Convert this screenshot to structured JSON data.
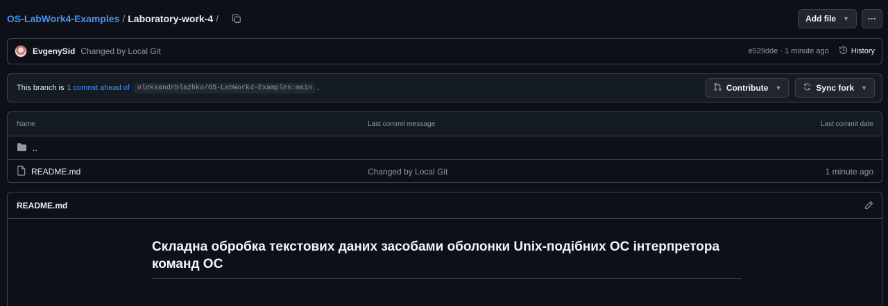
{
  "breadcrumb": {
    "repo": "OS-LabWork4-Examples",
    "separator": "/",
    "folder": "Laboratory-work-4",
    "trailing": "/"
  },
  "toolbar": {
    "add_file_label": "Add file",
    "more_label": "···"
  },
  "commit": {
    "author": "EvgenySid",
    "message": "Changed by Local Git",
    "meta": "e529dde · 1 minute ago",
    "history_label": "History"
  },
  "branch": {
    "prefix": "This branch is",
    "ahead_link": "1 commit ahead of",
    "ref": "oleksandrblazhko/OS-LabWork4-Examples:main",
    "suffix": ".",
    "contribute_label": "Contribute",
    "sync_label": "Sync fork"
  },
  "files": {
    "headers": {
      "name": "Name",
      "message": "Last commit message",
      "date": "Last commit date"
    },
    "rows": [
      {
        "name": "..",
        "message": "",
        "date": "",
        "icon": "folder-icon"
      },
      {
        "name": "README.md",
        "message": "Changed by Local Git",
        "date": "1 minute ago",
        "icon": "file-icon"
      }
    ]
  },
  "readme": {
    "header": "README.md",
    "title": "Складна обробка текстових даних засобами оболонки Unix-подібних ОС інтерпретора команд ОС"
  },
  "colors": {
    "background": "#0d1117",
    "link": "#4493f8",
    "border": "#3d444d",
    "muted": "#9198a1"
  }
}
